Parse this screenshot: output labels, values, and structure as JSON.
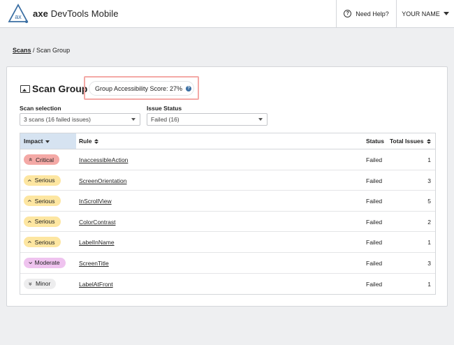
{
  "header": {
    "app_name_bold": "axe",
    "app_name_rest": "DevTools Mobile",
    "logo_text": "ax",
    "help_label": "Need Help?",
    "user_label": "YOUR NAME"
  },
  "breadcrumb": {
    "link": "Scans",
    "separator": " / ",
    "current": "Scan Group"
  },
  "card": {
    "title": "Scan Group",
    "score_label": "Group Accessibility Score: 27%",
    "scan_selection_label": "Scan selection",
    "scan_selection_value": "3 scans (16 failed issues)",
    "issue_status_label": "Issue Status",
    "issue_status_value": "Failed (16)"
  },
  "table": {
    "headers": {
      "impact": "Impact",
      "rule": "Rule",
      "status": "Status",
      "total": "Total Issues"
    },
    "rows": [
      {
        "impact": "Critical",
        "rule": "InaccessibleAction",
        "status": "Failed",
        "total": "1"
      },
      {
        "impact": "Serious",
        "rule": "ScreenOrientation",
        "status": "Failed",
        "total": "3"
      },
      {
        "impact": "Serious",
        "rule": "InScrollView",
        "status": "Failed",
        "total": "5"
      },
      {
        "impact": "Serious",
        "rule": "ColorContrast",
        "status": "Failed",
        "total": "2"
      },
      {
        "impact": "Serious",
        "rule": "LabelInName",
        "status": "Failed",
        "total": "1"
      },
      {
        "impact": "Moderate",
        "rule": "ScreenTitle",
        "status": "Failed",
        "total": "3"
      },
      {
        "impact": "Minor",
        "rule": "LabelAtFront",
        "status": "Failed",
        "total": "1"
      }
    ]
  },
  "colors": {
    "critical": "#f4a9a6",
    "serious": "#fde6a1",
    "moderate": "#efc3ef",
    "minor": "#ededee",
    "accent": "#3b6fa3",
    "highlight_border": "#f4a9a6"
  },
  "icons": {
    "critical": "double-chevron-up-icon",
    "serious": "chevron-up-icon",
    "moderate": "chevron-down-icon",
    "minor": "double-chevron-down-icon"
  }
}
